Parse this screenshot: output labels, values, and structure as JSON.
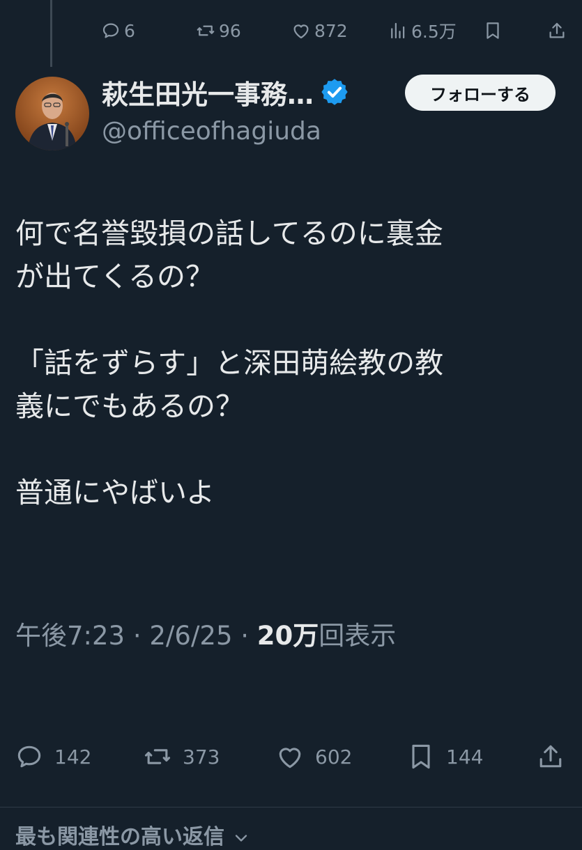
{
  "previous_tweet": {
    "replies": "6",
    "retweets": "96",
    "likes": "872",
    "views": "6.5万"
  },
  "author": {
    "display_name": "萩生田光一事務…",
    "handle": "@officeofhagiuda",
    "verified_color": "#1d9bf0",
    "follow_label": "フォローする"
  },
  "tweet": {
    "lines": [
      "何で名誉毀損の話してるのに裏金\nが出てくるの？",
      "「話をずらす」と深田萌絵教の教\n義にでもあるの？",
      "普通にやばいよ"
    ],
    "time": "午後7:23",
    "date": "2/6/25",
    "views_count": "20万",
    "views_label": "回表示",
    "separator": " · "
  },
  "stats": {
    "replies": "142",
    "retweets": "373",
    "likes": "602",
    "bookmarks": "144"
  },
  "replies_sort_label": "最も関連性の高い返信",
  "colors": {
    "background": "#15202b",
    "text": "#e7e9ea",
    "muted": "#8b98a5",
    "accent": "#1d9bf0"
  }
}
